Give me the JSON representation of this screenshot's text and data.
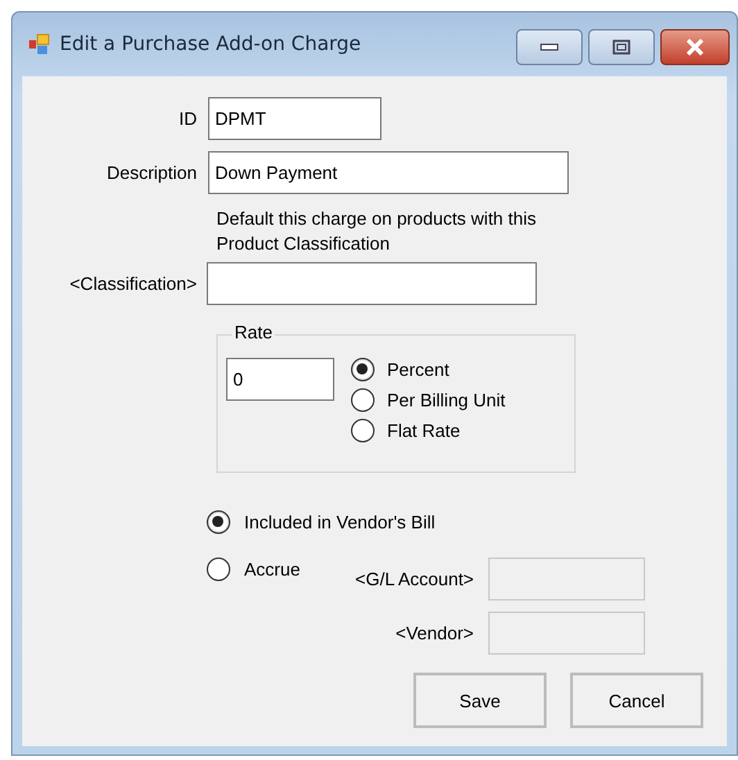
{
  "window": {
    "title": "Edit a Purchase Add-on Charge"
  },
  "id": {
    "label": "ID",
    "value": "DPMT"
  },
  "description": {
    "label": "Description",
    "value": "Down Payment"
  },
  "classification_note": "Default this charge on products with this Product Classification",
  "classification": {
    "label": "<Classification>"
  },
  "rate": {
    "label": "Rate",
    "value": "0",
    "options": [
      {
        "label": "Percent",
        "selected": true
      },
      {
        "label": "Per Billing Unit",
        "selected": false
      },
      {
        "label": "Flat Rate",
        "selected": false
      }
    ]
  },
  "billing": [
    {
      "label": "Included in Vendor's Bill",
      "selected": true
    },
    {
      "label": "Accrue",
      "selected": false
    }
  ],
  "gl_account": {
    "label": "<G/L Account>",
    "disabled": true
  },
  "vendor": {
    "label": "<Vendor>",
    "disabled": true
  },
  "buttons": [
    "Save",
    "Cancel"
  ]
}
